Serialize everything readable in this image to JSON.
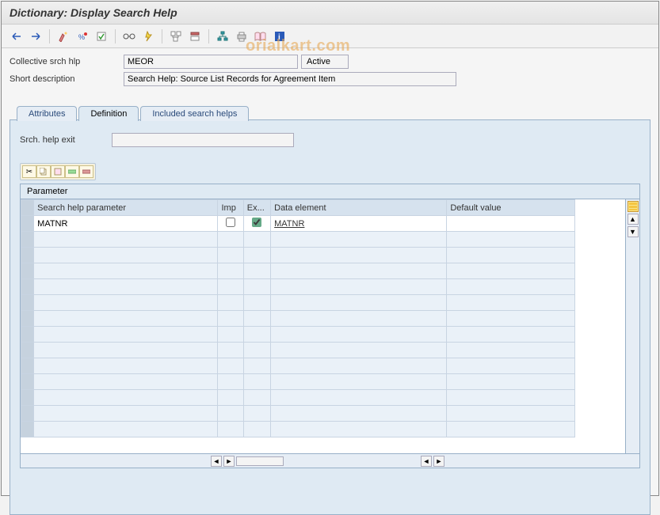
{
  "title": "Dictionary: Display Search Help",
  "watermark": "orialkart.com",
  "toolbar_icons": [
    "arrow-left",
    "arrow-right",
    "sep",
    "wand",
    "pct",
    "clipboard",
    "sep",
    "glasses",
    "wrench",
    "sep",
    "tree",
    "activate",
    "sep",
    "hierarchy",
    "print",
    "docu",
    "info"
  ],
  "header": {
    "collective_label": "Collective srch hlp",
    "collective_value": "MEOR",
    "status": "Active",
    "shortdesc_label": "Short description",
    "shortdesc_value": "Search Help: Source List Records for Agreement Item"
  },
  "tabs": [
    "Attributes",
    "Definition",
    "Included search helps"
  ],
  "active_tab": 1,
  "exit": {
    "label": "Srch. help exit",
    "value": ""
  },
  "param_section_title": "Parameter",
  "columns": {
    "shp": "Search help parameter",
    "imp": "Imp",
    "exp": "Ex...",
    "de": "Data element",
    "def": "Default value"
  },
  "rows": [
    {
      "param": "MATNR",
      "imp": false,
      "exp": true,
      "de": "MATNR",
      "def": ""
    }
  ],
  "empty_rows": 13
}
